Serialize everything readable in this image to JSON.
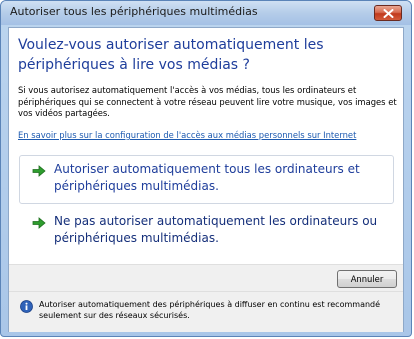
{
  "window": {
    "title": "Autoriser tous les périphériques multimédias"
  },
  "main": {
    "heading": "Voulez-vous autoriser automatiquement les périphériques à lire vos médias ?",
    "description": "Si vous autorisez automatiquement l'accès à vos médias, tous les ordinateurs et périphériques qui se connectent à votre réseau peuvent lire votre musique, vos images et vos vidéos partagées.",
    "link_text": "En savoir plus sur la configuration de l'accès aux médias personnels sur Internet"
  },
  "options": [
    {
      "label": "Autoriser automatiquement tous les ordinateurs et périphériques multimédias.",
      "icon": "green-arrow-icon",
      "selected": true
    },
    {
      "label": "Ne pas autoriser automatiquement les ordinateurs ou périphériques multimédias.",
      "icon": "green-arrow-icon",
      "selected": false
    }
  ],
  "footer": {
    "cancel_label": "Annuler",
    "info_icon": "info-icon",
    "info_text": "Autoriser automatiquement des périphériques à diffuser en continu est recommandé seulement sur des réseaux sécurisés."
  },
  "colors": {
    "heading": "#1e3d9b",
    "link": "#1d5ab0",
    "arrow": "#2e9d2e",
    "close_button": "#c13a1c"
  }
}
